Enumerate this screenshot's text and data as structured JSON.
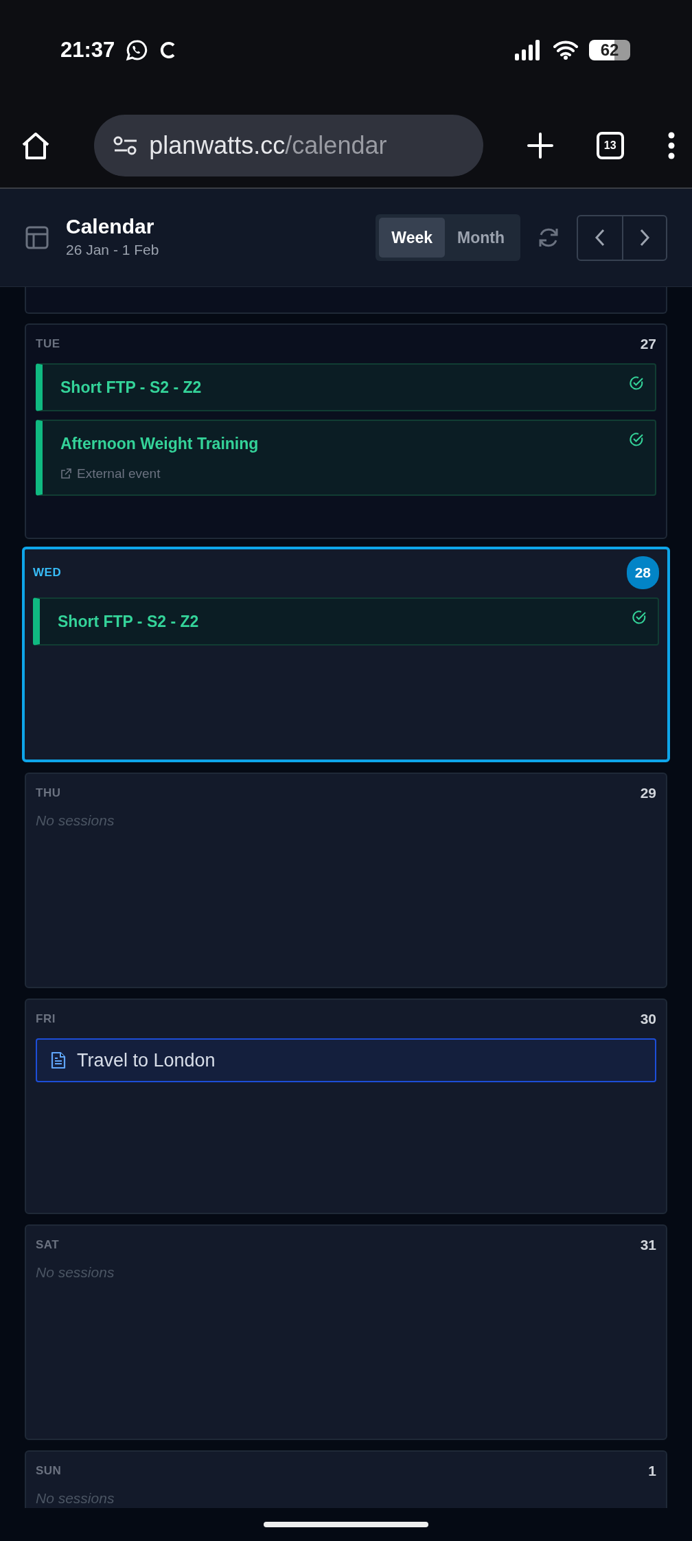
{
  "status_bar": {
    "time": "21:37",
    "battery": "62"
  },
  "browser": {
    "url_host": "planwatts.cc",
    "url_path": "/calendar",
    "tab_count": "13"
  },
  "header": {
    "title": "Calendar",
    "subtitle": "26 Jan - 1 Feb",
    "views": [
      {
        "label": "Week",
        "selected": true
      },
      {
        "label": "Month",
        "selected": false
      }
    ]
  },
  "days": [
    {
      "day": "TUE",
      "date": "27",
      "selected": false,
      "past": true,
      "events": [
        {
          "kind": "workout",
          "title": "Short FTP - S2 - Z2",
          "completed": true
        },
        {
          "kind": "workout",
          "title": "Afternoon Weight Training",
          "subtitle": "External event",
          "completed": true
        }
      ]
    },
    {
      "day": "WED",
      "date": "28",
      "selected": true,
      "past": false,
      "events": [
        {
          "kind": "workout",
          "title": "Short FTP - S2 - Z2",
          "completed": true
        }
      ]
    },
    {
      "day": "THU",
      "date": "29",
      "selected": false,
      "past": false,
      "empty_text": "No sessions"
    },
    {
      "day": "FRI",
      "date": "30",
      "selected": false,
      "past": false,
      "events": [
        {
          "kind": "note",
          "title": "Travel to London"
        }
      ]
    },
    {
      "day": "SAT",
      "date": "31",
      "selected": false,
      "past": false,
      "empty_text": "No sessions"
    },
    {
      "day": "SUN",
      "date": "1",
      "selected": false,
      "past": false,
      "empty_text": "No sessions"
    }
  ]
}
